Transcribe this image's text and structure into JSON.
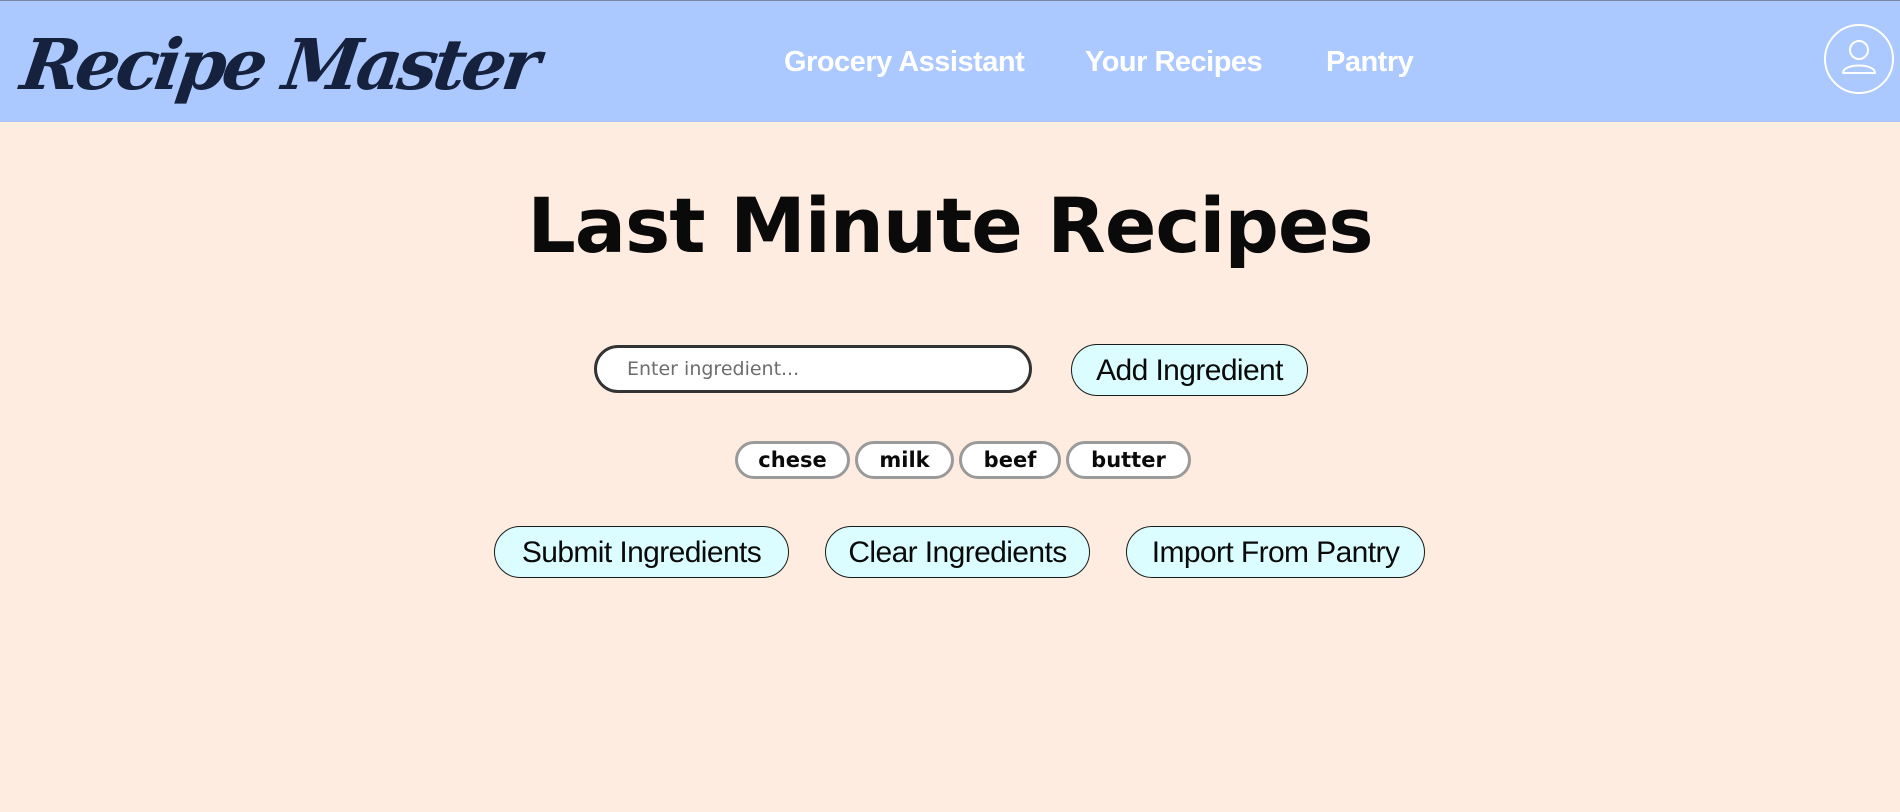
{
  "header": {
    "logo_text": "Recipe Master",
    "nav": [
      {
        "label": "Grocery Assistant"
      },
      {
        "label": "Your Recipes"
      },
      {
        "label": "Pantry"
      }
    ],
    "account_icon": "user-avatar-icon"
  },
  "main": {
    "title": "Last Minute Recipes",
    "ingredient_input": {
      "placeholder": "Enter ingredient...",
      "value": ""
    },
    "add_button_label": "Add Ingredient",
    "ingredients": [
      "chese",
      "milk",
      "beef",
      "butter"
    ],
    "actions": {
      "submit_label": "Submit Ingredients",
      "clear_label": "Clear Ingredients",
      "import_label": "Import From Pantry"
    }
  },
  "colors": {
    "header_bg": "#abc8ff",
    "page_bg": "#ffece0",
    "button_bg": "#dbfdff",
    "logo_color": "#15213d"
  }
}
